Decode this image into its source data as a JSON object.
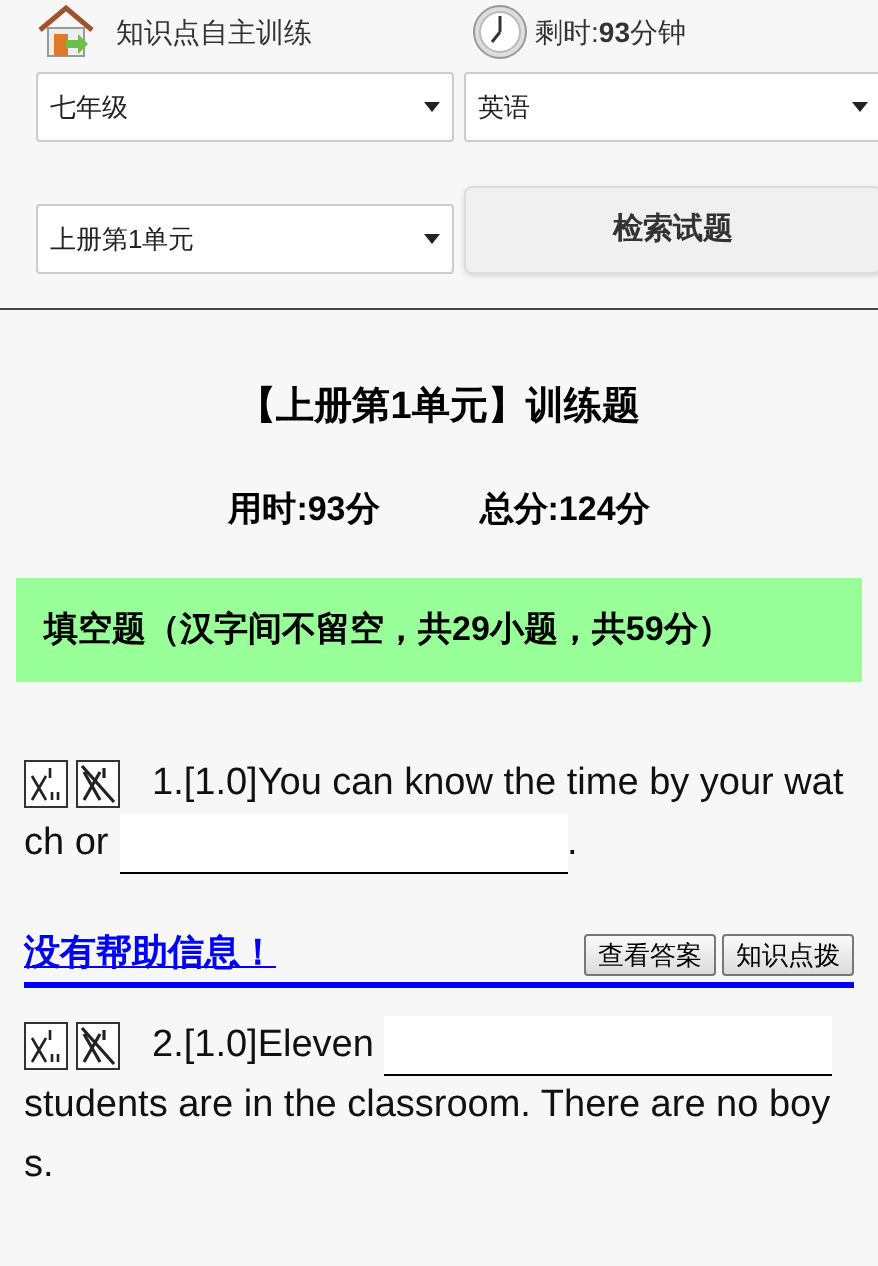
{
  "header": {
    "title": "知识点自主训练",
    "timer_label": "剩时:",
    "timer_value": "93",
    "timer_unit": "分钟"
  },
  "filters": [
    {
      "kind": "select",
      "value": "七年级"
    },
    {
      "kind": "select",
      "value": "英语"
    },
    {
      "kind": "select",
      "value": "上册第1单元"
    },
    {
      "kind": "button",
      "value": "检索试题"
    }
  ],
  "exam": {
    "title": "【上册第1单元】训练题",
    "time_used": "用时:93分",
    "total_score": "总分:124分"
  },
  "section": {
    "heading": "填空题（汉字间不留空，共29小题，共59分）"
  },
  "questions": [
    {
      "number": "1.[1.0]",
      "parts": [
        {
          "kind": "text",
          "text": "You can know the time by your watch or "
        },
        {
          "kind": "blank"
        },
        {
          "kind": "text",
          "text": "."
        }
      ],
      "help": "没有帮助信息！",
      "buttons": [
        "查看答案",
        "知识点拨"
      ]
    },
    {
      "number": "2.[1.0]",
      "parts": [
        {
          "kind": "text",
          "text": "Eleven "
        },
        {
          "kind": "blank"
        },
        {
          "kind": "text",
          "text": " students are in the classroom. There are no boys."
        }
      ]
    }
  ]
}
